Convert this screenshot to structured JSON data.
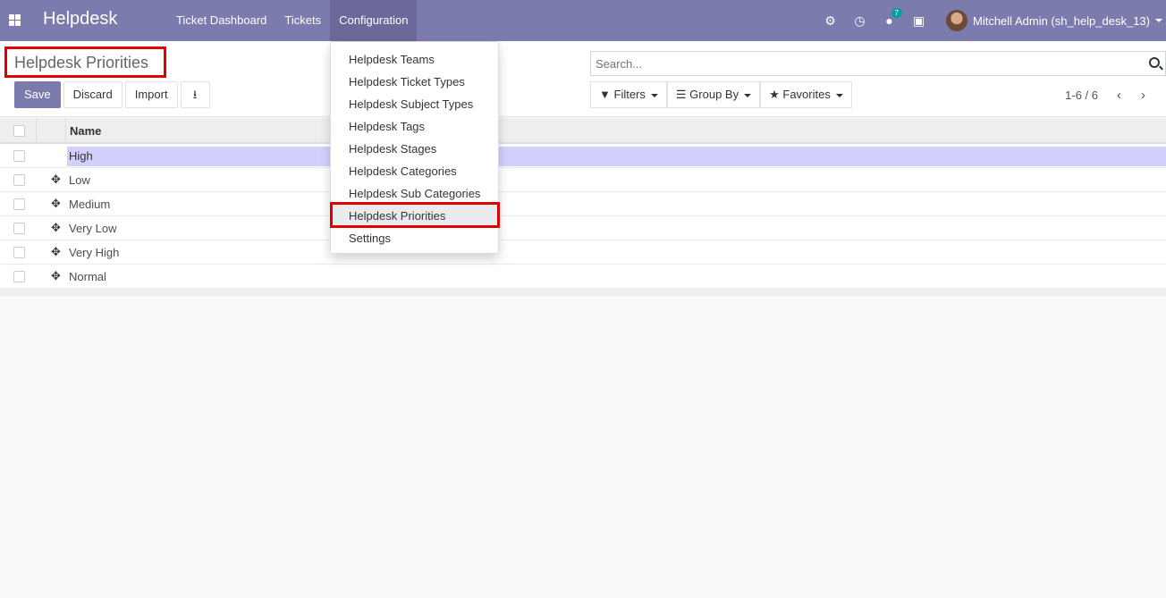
{
  "navbar": {
    "brand": "Helpdesk",
    "menu": [
      "Ticket Dashboard",
      "Tickets",
      "Configuration"
    ],
    "active_menu": "Configuration",
    "messages_count": "7",
    "user": "Mitchell Admin (sh_help_desk_13)"
  },
  "control": {
    "title": "Helpdesk Priorities",
    "buttons": {
      "save": "Save",
      "discard": "Discard",
      "import": "Import"
    },
    "search_placeholder": "Search...",
    "filters": "Filters",
    "group_by": "Group By",
    "favorites": "Favorites",
    "pager": "1-6 / 6"
  },
  "list": {
    "header": "Name",
    "rows": [
      "High",
      "Low",
      "Medium",
      "Very Low",
      "Very High",
      "Normal"
    ]
  },
  "config_menu": {
    "items": [
      "Helpdesk Teams",
      "Helpdesk Ticket Types",
      "Helpdesk Subject Types",
      "Helpdesk Tags",
      "Helpdesk Stages",
      "Helpdesk Categories",
      "Helpdesk Sub Categories",
      "Helpdesk Priorities",
      "Settings"
    ],
    "active_item": "Helpdesk Priorities"
  },
  "colors": {
    "brand": "#7c7bad",
    "highlight": "#e00000",
    "editing_row": "#d3d0fb"
  }
}
